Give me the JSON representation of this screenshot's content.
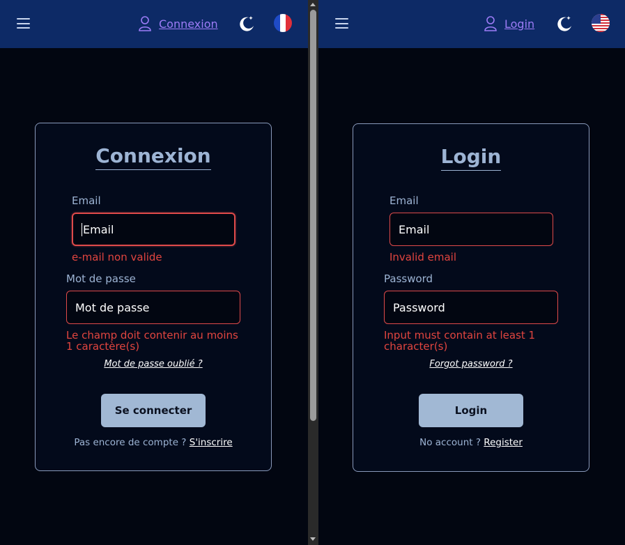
{
  "colors": {
    "navbar": "#0d2a66",
    "background": "#020611",
    "accent_link": "#9d7cf7",
    "label": "#9db4d4",
    "error": "#e2453f",
    "button": "#a1b8d4"
  },
  "panes": [
    {
      "lang": "fr",
      "nav": {
        "menu_icon": "hamburger-menu-icon",
        "login_label": "Connexion",
        "theme_icon": "moon-icon",
        "flag": "france-flag-icon"
      },
      "form": {
        "title": "Connexion",
        "email_label": "Email",
        "email_value": "Email",
        "email_error": "e-mail non valide",
        "password_label": "Mot de passe",
        "password_value": "Mot de passe",
        "password_error": "Le champ doit contenir au moins 1 caractère(s)",
        "forgot": "Mot de passe oublié ?",
        "submit": "Se connecter",
        "no_account": "Pas encore de compte ?",
        "register": "S'inscrire"
      }
    },
    {
      "lang": "en",
      "nav": {
        "menu_icon": "hamburger-menu-icon",
        "login_label": "Login",
        "theme_icon": "moon-icon",
        "flag": "usa-flag-icon"
      },
      "form": {
        "title": "Login",
        "email_label": "Email",
        "email_value": "Email",
        "email_error": "Invalid email",
        "password_label": "Password",
        "password_value": "Password",
        "password_error": "Input must contain at least 1 character(s)",
        "forgot": "Forgot password ?",
        "submit": "Login",
        "no_account": "No account ?",
        "register": "Register"
      }
    }
  ]
}
